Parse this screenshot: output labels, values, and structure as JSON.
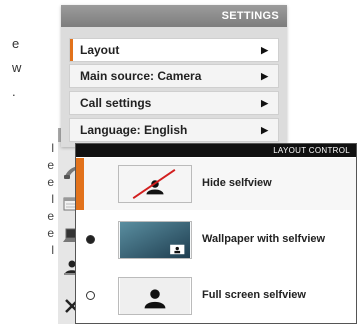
{
  "settings": {
    "title": "SETTINGS",
    "items": [
      {
        "label": "Layout"
      },
      {
        "label": "Main source: Camera"
      },
      {
        "label": "Call settings"
      },
      {
        "label": "Language: English"
      }
    ]
  },
  "layout_control": {
    "title": "LAYOUT CONTROL",
    "options": [
      {
        "label": "Hide selfview"
      },
      {
        "label": "Wallpaper with selfview"
      },
      {
        "label": "Full screen selfview"
      }
    ]
  },
  "background_text": {
    "top_fragments": [
      "e",
      "w",
      "."
    ],
    "left_fragments": [
      "l",
      "e",
      "e",
      "l",
      "e",
      "e",
      "l"
    ]
  },
  "colors": {
    "accent": "#e2721b",
    "header_dark": "#111111",
    "settings_header": "#8a8a8a"
  },
  "sidebar_icons": [
    "phone-icon",
    "calendar-icon",
    "laptop-icon",
    "selfview-icon",
    "tools-icon"
  ]
}
